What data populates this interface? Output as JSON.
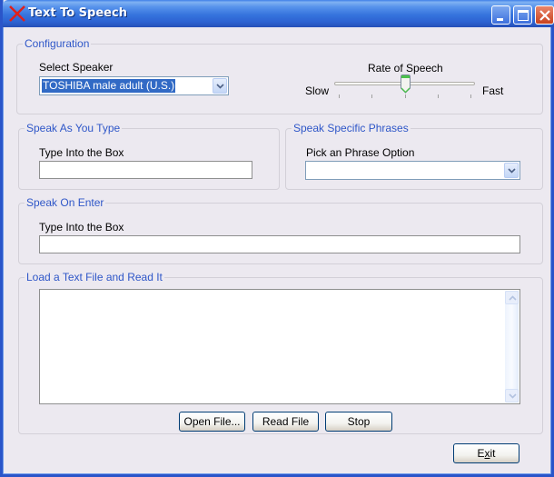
{
  "window": {
    "title": "Text To Speech",
    "app_icon": "red-x-icon",
    "controls": [
      "minimize",
      "maximize",
      "close"
    ]
  },
  "configuration": {
    "legend": "Configuration",
    "speaker_label": "Select Speaker",
    "speaker_selected": "TOSHIBA male adult (U.S.)",
    "rate_label": "Rate of Speech",
    "rate_min_label": "Slow",
    "rate_max_label": "Fast",
    "rate_tick_count": 5,
    "rate_value_fraction": 0.5
  },
  "speak_as_you_type": {
    "legend": "Speak As You Type",
    "label": "Type Into the Box",
    "value": ""
  },
  "speak_specific_phrases": {
    "legend": "Speak Specific Phrases",
    "label": "Pick an Phrase Option",
    "selected": ""
  },
  "speak_on_enter": {
    "legend": "Speak On Enter",
    "label": "Type Into the Box",
    "value": ""
  },
  "load_text_file": {
    "legend": "Load a Text File and Read It",
    "content": "",
    "buttons": {
      "open": "Open File...",
      "read": "Read File",
      "stop": "Stop"
    }
  },
  "footer": {
    "exit_label": "Exit",
    "exit_mnemonic": "x"
  }
}
